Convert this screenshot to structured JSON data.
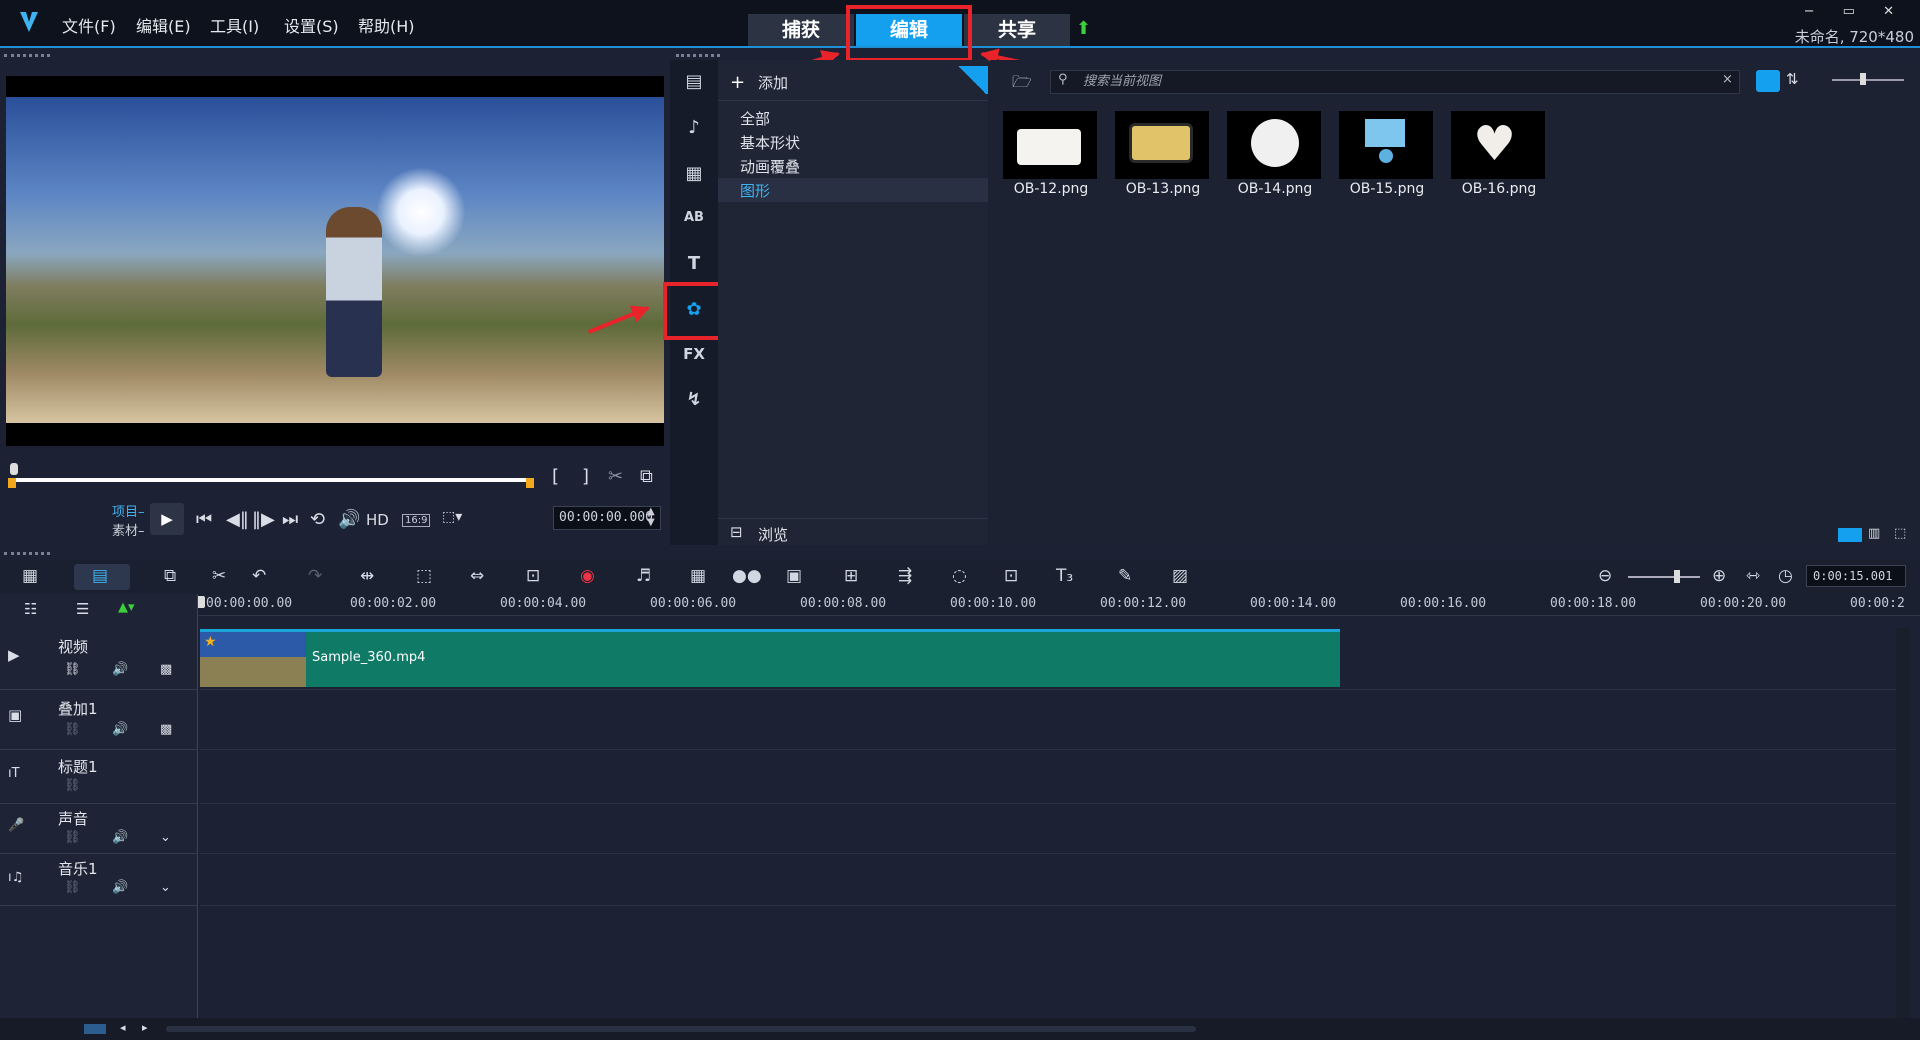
{
  "app": {
    "menus": [
      "文件(F)",
      "编辑(E)",
      "工具(I)",
      "设置(S)",
      "帮助(H)"
    ],
    "modes": [
      "捕获",
      "编辑",
      "共享"
    ],
    "project_info": "未命名, 720*480",
    "window_controls": "− ▭ ✕"
  },
  "player": {
    "mode_project": "项目–",
    "mode_clip": "素材–",
    "hd_label": "HD",
    "aspect_label": "16:9",
    "timecode": "00:00:00.000",
    "scrub_progress": 0.0
  },
  "library": {
    "add_label": "添加",
    "categories": [
      "全部",
      "基本形状",
      "动画覆叠",
      "图形"
    ],
    "selected_category": "图形",
    "browse_label": "浏览",
    "search_placeholder": "搜索当前视图",
    "items": [
      "OB-12.png",
      "OB-13.png",
      "OB-14.png",
      "OB-15.png",
      "OB-16.png"
    ]
  },
  "sidebar_icons": [
    "media-icon",
    "instant-project-icon",
    "transition-icon",
    "title-icon",
    "text-icon",
    "overlay-graphics-icon",
    "fx-icon",
    "path-icon"
  ],
  "sidebar_fx_label": "FX",
  "timeline": {
    "total_time": "0:00:15.001",
    "ruler_ticks": [
      "00:00:00.00",
      "00:00:02.00",
      "00:00:04.00",
      "00:00:06.00",
      "00:00:08.00",
      "00:00:10.00",
      "00:00:12.00",
      "00:00:14.00",
      "00:00:16.00",
      "00:00:18.00",
      "00:00:20.00",
      "00:00:2"
    ],
    "tracks": [
      "视频",
      "叠加1",
      "标题1",
      "声音",
      "音乐1"
    ],
    "clip_name": "Sample_360.mp4"
  },
  "colors": {
    "accent": "#14a0ef",
    "highlight": "#e8232a",
    "clip": "#0f7a66"
  }
}
